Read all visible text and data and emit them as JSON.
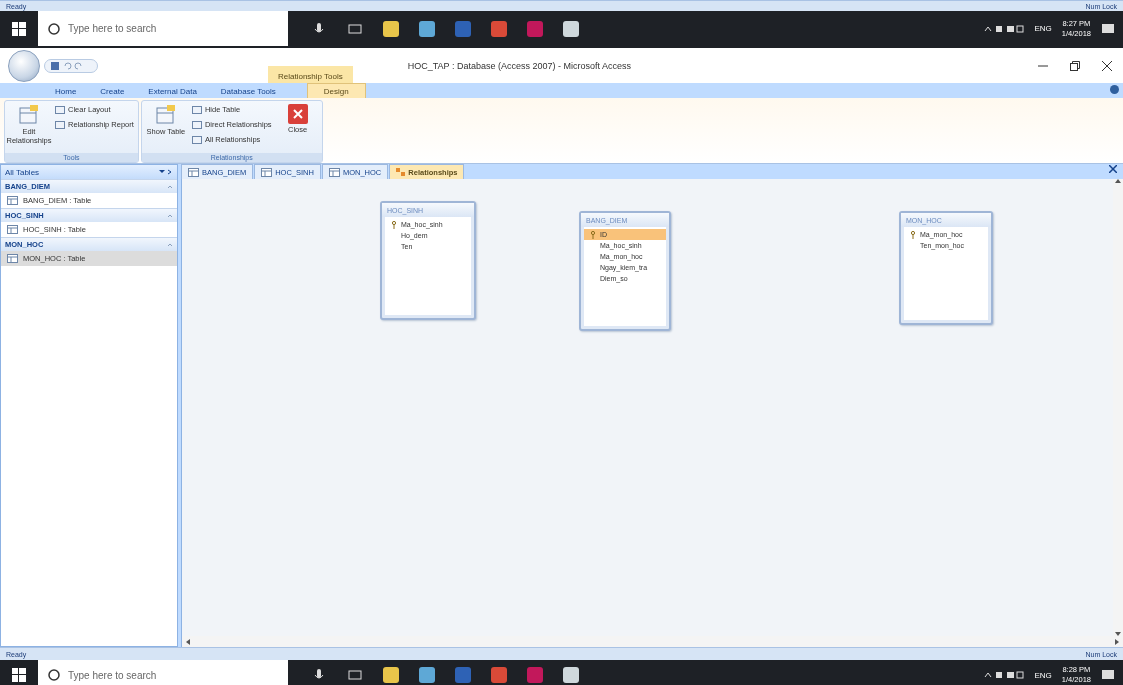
{
  "top_status_bar": {
    "left": "Ready",
    "right": "Num Lock"
  },
  "top_taskbar": {
    "search_placeholder": "Type here to search",
    "language": "ENG",
    "time": "8:27 PM",
    "date": "1/4/2018"
  },
  "window": {
    "title": "HOC_TAP : Database (Access 2007) - Microsoft Access",
    "contextual_group": "Relationship Tools",
    "ribbon_tabs": [
      {
        "label": "Home",
        "selected": false
      },
      {
        "label": "Create",
        "selected": false
      },
      {
        "label": "External Data",
        "selected": false
      },
      {
        "label": "Database Tools",
        "selected": false
      },
      {
        "label": "Design",
        "selected": true
      }
    ],
    "ribbon_groups": [
      {
        "label": "Tools",
        "buttons": [
          {
            "label": "Edit Relationships",
            "kind": "large"
          },
          {
            "label": "Clear Layout",
            "kind": "small"
          },
          {
            "label": "Relationship Report",
            "kind": "small"
          }
        ]
      },
      {
        "label": "Relationships",
        "buttons": [
          {
            "label": "Show Table",
            "kind": "large"
          },
          {
            "label": "Hide Table",
            "kind": "small"
          },
          {
            "label": "Direct Relationships",
            "kind": "small"
          },
          {
            "label": "All Relationships",
            "kind": "small"
          },
          {
            "label": "Close",
            "kind": "close"
          }
        ]
      }
    ]
  },
  "nav_pane": {
    "header": "All Tables",
    "groups": [
      {
        "label": "BANG_DIEM",
        "items": [
          {
            "label": "BANG_DIEM : Table",
            "selected": false
          }
        ]
      },
      {
        "label": "HOC_SINH",
        "items": [
          {
            "label": "HOC_SINH : Table",
            "selected": false
          }
        ]
      },
      {
        "label": "MON_HOC",
        "items": [
          {
            "label": "MON_HOC : Table",
            "selected": true
          }
        ]
      }
    ]
  },
  "document_tabs": [
    {
      "label": "BANG_DIEM",
      "selected": false
    },
    {
      "label": "HOC_SINH",
      "selected": false
    },
    {
      "label": "MON_HOC",
      "selected": false
    },
    {
      "label": "Relationships",
      "selected": true
    }
  ],
  "tables": [
    {
      "title": "HOC_SINH",
      "fields": [
        {
          "name": "Ma_hoc_sinh",
          "primary_key": true,
          "selected": false
        },
        {
          "name": "Ho_dem",
          "primary_key": false,
          "selected": false
        },
        {
          "name": "Ten",
          "primary_key": false,
          "selected": false
        }
      ]
    },
    {
      "title": "BANG_DIEM",
      "fields": [
        {
          "name": "ID",
          "primary_key": true,
          "selected": true
        },
        {
          "name": "Ma_hoc_sinh",
          "primary_key": false,
          "selected": false
        },
        {
          "name": "Ma_mon_hoc",
          "primary_key": false,
          "selected": false
        },
        {
          "name": "Ngay_kiem_tra",
          "primary_key": false,
          "selected": false
        },
        {
          "name": "Diem_so",
          "primary_key": false,
          "selected": false
        }
      ]
    },
    {
      "title": "MON_HOC",
      "fields": [
        {
          "name": "Ma_mon_hoc",
          "primary_key": true,
          "selected": false
        },
        {
          "name": "Ten_mon_hoc",
          "primary_key": false,
          "selected": false
        }
      ]
    }
  ],
  "status_bar": {
    "left": "Ready",
    "right": "Num Lock"
  },
  "taskbar": {
    "search_placeholder": "Type here to search",
    "language": "ENG",
    "time": "8:28 PM",
    "date": "1/4/2018"
  }
}
